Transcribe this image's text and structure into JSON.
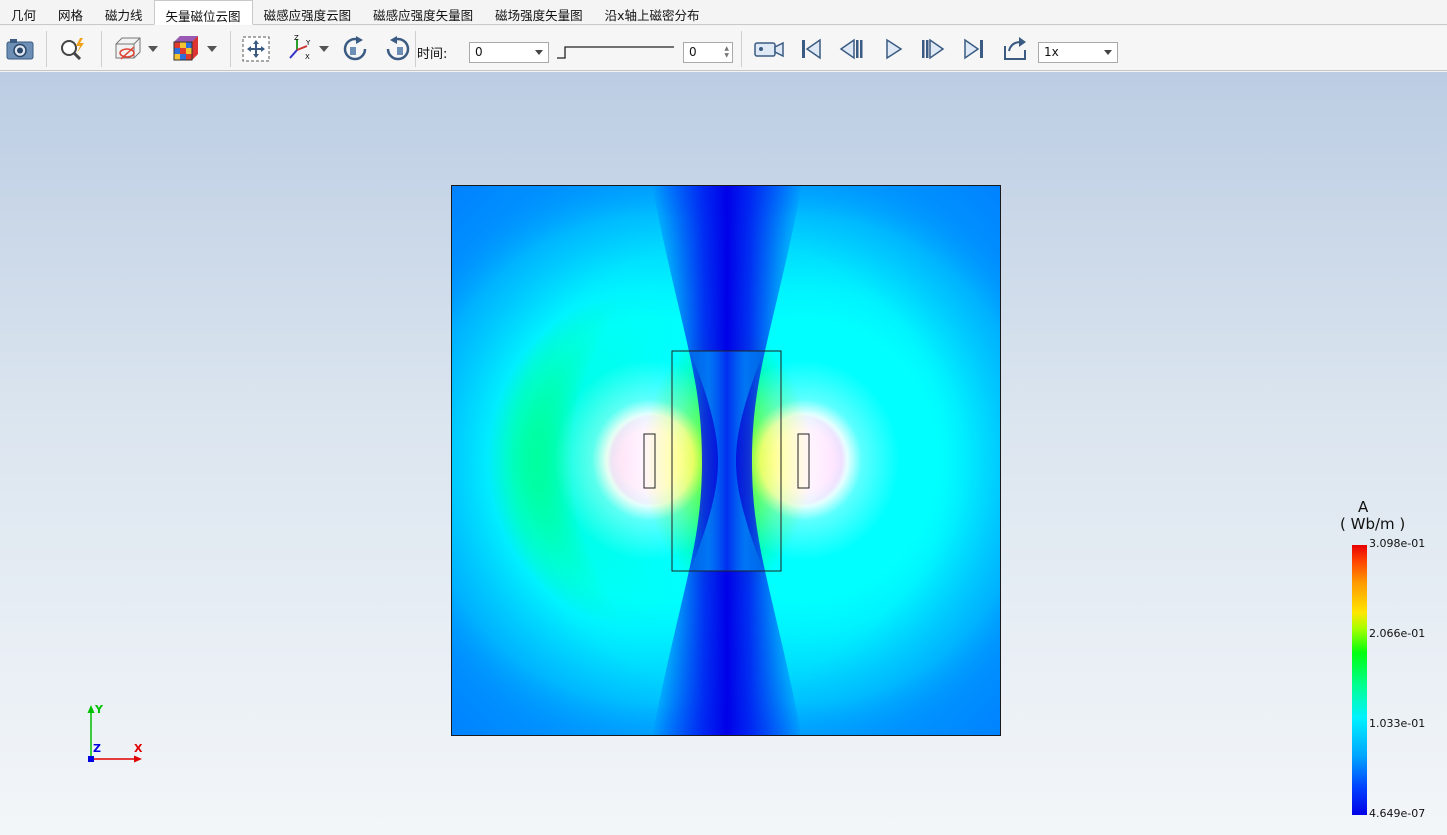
{
  "tabs": [
    "几何",
    "网格",
    "磁力线",
    "矢量磁位云图",
    "磁感应强度云图",
    "磁感应强度矢量图",
    "磁场强度矢量图",
    "沿x轴上磁密分布"
  ],
  "active_tab": "矢量磁位云图",
  "toolbar": {
    "icons": [
      "camera-icon",
      "zoom-fit-icon",
      "display-mode-icon",
      "color-cube-icon",
      "pan-icon",
      "axes-orientation-icon",
      "rotate-cw-icon",
      "rotate-ccw-icon",
      "record-video-icon",
      "first-frame-icon",
      "step-back-icon",
      "play-icon",
      "step-forward-icon",
      "last-frame-icon",
      "loop-icon"
    ],
    "time_label": "时间:",
    "time_value": "0",
    "frame_value": "0",
    "speed_value": "1x",
    "slider_level": 0
  },
  "legend": {
    "quantity": "A",
    "unit": "( Wb/m )",
    "ticks": [
      "3.098e-01",
      "2.066e-01",
      "1.033e-01",
      "4.649e-07"
    ],
    "colors": [
      "#e80000",
      "#ffe600",
      "#00ff10",
      "#00f2ff",
      "#0000e6"
    ]
  },
  "axes": {
    "x_label": "X",
    "y_label": "Y",
    "z_label": "Z",
    "x_color": "#e00000",
    "y_color": "#00c000",
    "z_color": "#0000e0"
  }
}
